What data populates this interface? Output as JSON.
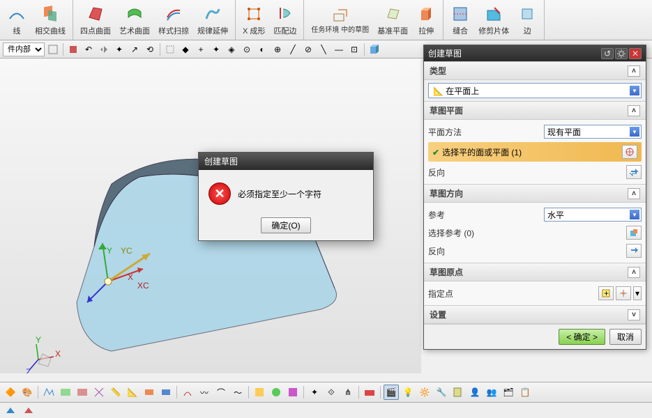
{
  "ribbon": {
    "g1": [
      {
        "label": "线",
        "key": "line"
      },
      {
        "label": "相交曲线",
        "key": "intersection-curve"
      }
    ],
    "g2": [
      {
        "label": "四点曲面",
        "key": "four-point-surface"
      },
      {
        "label": "艺术曲面",
        "key": "art-surface"
      },
      {
        "label": "样式扫掠",
        "key": "style-sweep"
      },
      {
        "label": "规律延伸",
        "key": "law-extension"
      }
    ],
    "g3": [
      {
        "label": "X 成形",
        "key": "x-form"
      },
      {
        "label": "匹配边",
        "key": "match-edge"
      }
    ],
    "g4": [
      {
        "label": "任务环境\n中的草图",
        "key": "task-sketch"
      },
      {
        "label": "基准平面",
        "key": "datum-plane"
      },
      {
        "label": "拉伸",
        "key": "extrude"
      }
    ],
    "g5": [
      {
        "label": "缝合",
        "key": "sew"
      },
      {
        "label": "修剪片体",
        "key": "trim-sheet"
      },
      {
        "label": "边",
        "key": "edge"
      }
    ]
  },
  "subtoolbar": {
    "combo": "件内部"
  },
  "panel": {
    "title": "创建草图",
    "type_header": "类型",
    "type_value": "在平面上",
    "plane_header": "草图平面",
    "plane_method_label": "平面方法",
    "plane_method_value": "现有平面",
    "select_face_label": "选择平的面或平面 (1)",
    "reverse_label": "反向",
    "dir_header": "草图方向",
    "ref_label": "参考",
    "ref_value": "水平",
    "select_ref_label": "选择参考 (0)",
    "reverse2_label": "反向",
    "origin_header": "草图原点",
    "specify_point": "指定点",
    "settings_header": "设置",
    "ok": "< 确定 >",
    "cancel": "取消"
  },
  "modal": {
    "title": "创建草图",
    "message": "必须指定至少一个字符",
    "ok": "确定(O)"
  }
}
